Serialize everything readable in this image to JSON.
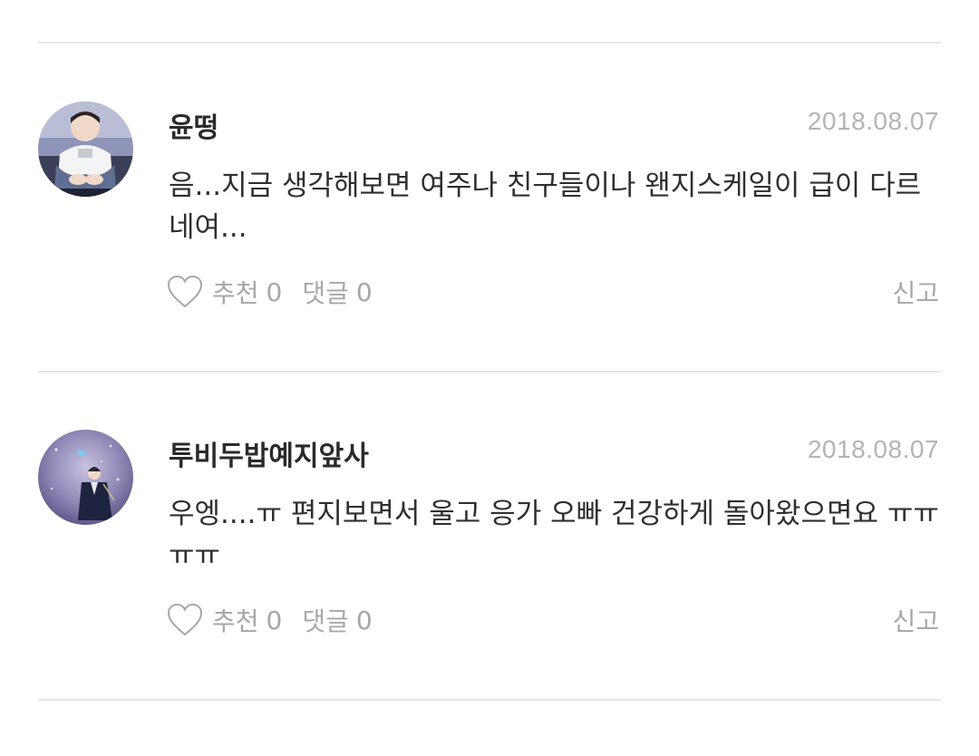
{
  "comments": [
    {
      "username": "윤떵",
      "date": "2018.08.07",
      "text": "음...지금 생각해보면 여주나 친구들이나 왠지스케일이 급이 다르네여...",
      "like_label": "추천",
      "like_count": "0",
      "reply_label": "댓글",
      "reply_count": "0",
      "report_label": "신고",
      "avatar_icon": "avatar-photo"
    },
    {
      "username": "투비두밥예지앞사",
      "date": "2018.08.07",
      "text": "우엥....ㅠ 편지보면서 울고 응가 오빠 건강하게 돌아왔으면요 ㅠㅠ ㅠㅠ",
      "like_label": "추천",
      "like_count": "0",
      "reply_label": "댓글",
      "reply_count": "0",
      "report_label": "신고",
      "avatar_icon": "avatar-photo"
    }
  ],
  "colors": {
    "text": "#2f2f2f",
    "muted": "#a7a7a7",
    "date": "#b4b4b4",
    "divider": "#e6e6e6"
  }
}
